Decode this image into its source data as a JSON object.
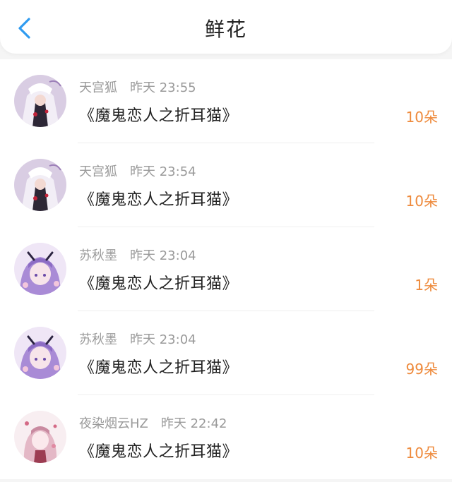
{
  "header": {
    "title": "鲜花"
  },
  "flowers": [
    {
      "user": "天宫狐",
      "time": "昨天 23:55",
      "book": "《魔鬼恋人之折耳猫》",
      "amount": "10朵",
      "avatar": "avatar-white-hood"
    },
    {
      "user": "天宫狐",
      "time": "昨天 23:54",
      "book": "《魔鬼恋人之折耳猫》",
      "amount": "10朵",
      "avatar": "avatar-white-hood"
    },
    {
      "user": "苏秋墨",
      "time": "昨天 23:04",
      "book": "《魔鬼恋人之折耳猫》",
      "amount": "1朵",
      "avatar": "avatar-purple-hair"
    },
    {
      "user": "苏秋墨",
      "time": "昨天 23:04",
      "book": "《魔鬼恋人之折耳猫》",
      "amount": "99朵",
      "avatar": "avatar-purple-hair"
    },
    {
      "user": "夜染烟云HZ",
      "time": "昨天 22:42",
      "book": "《魔鬼恋人之折耳猫》",
      "amount": "10朵",
      "avatar": "avatar-pink-girl"
    }
  ],
  "colors": {
    "accent": "#2f9bf0",
    "amount": "#ee8a3c",
    "meta": "#9a9a9a",
    "text": "#222222"
  }
}
